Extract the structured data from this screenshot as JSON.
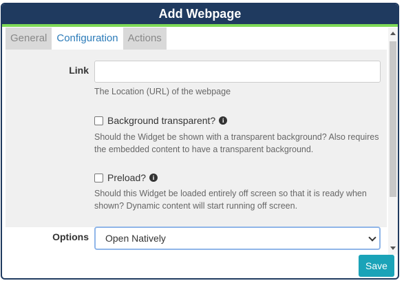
{
  "dialog": {
    "title": "Add Webpage",
    "tabs": [
      {
        "label": "General"
      },
      {
        "label": "Configuration"
      },
      {
        "label": "Actions"
      }
    ]
  },
  "form": {
    "link": {
      "label": "Link",
      "value": "",
      "placeholder": "",
      "help": "The Location (URL) of the webpage"
    },
    "background_transparent": {
      "label": "Background transparent?",
      "checked": false,
      "help": "Should the Widget be shown with a transparent background? Also requires the embedded content to have a transparent background."
    },
    "preload": {
      "label": "Preload?",
      "checked": false,
      "help": "Should this Widget be loaded entirely off screen so that it is ready when shown? Dynamic content will start running off screen."
    },
    "options": {
      "label": "Options",
      "selected": "Open Natively"
    }
  },
  "footer": {
    "save_label": "Save"
  },
  "colors": {
    "titlebar": "#1f3a5f",
    "accent_bar": "#7ed957",
    "active_tab": "#2b7bb9",
    "save_button": "#1aa3b8"
  },
  "icons": {
    "info": "info-circle-icon",
    "chevron": "chevron-down-icon"
  }
}
